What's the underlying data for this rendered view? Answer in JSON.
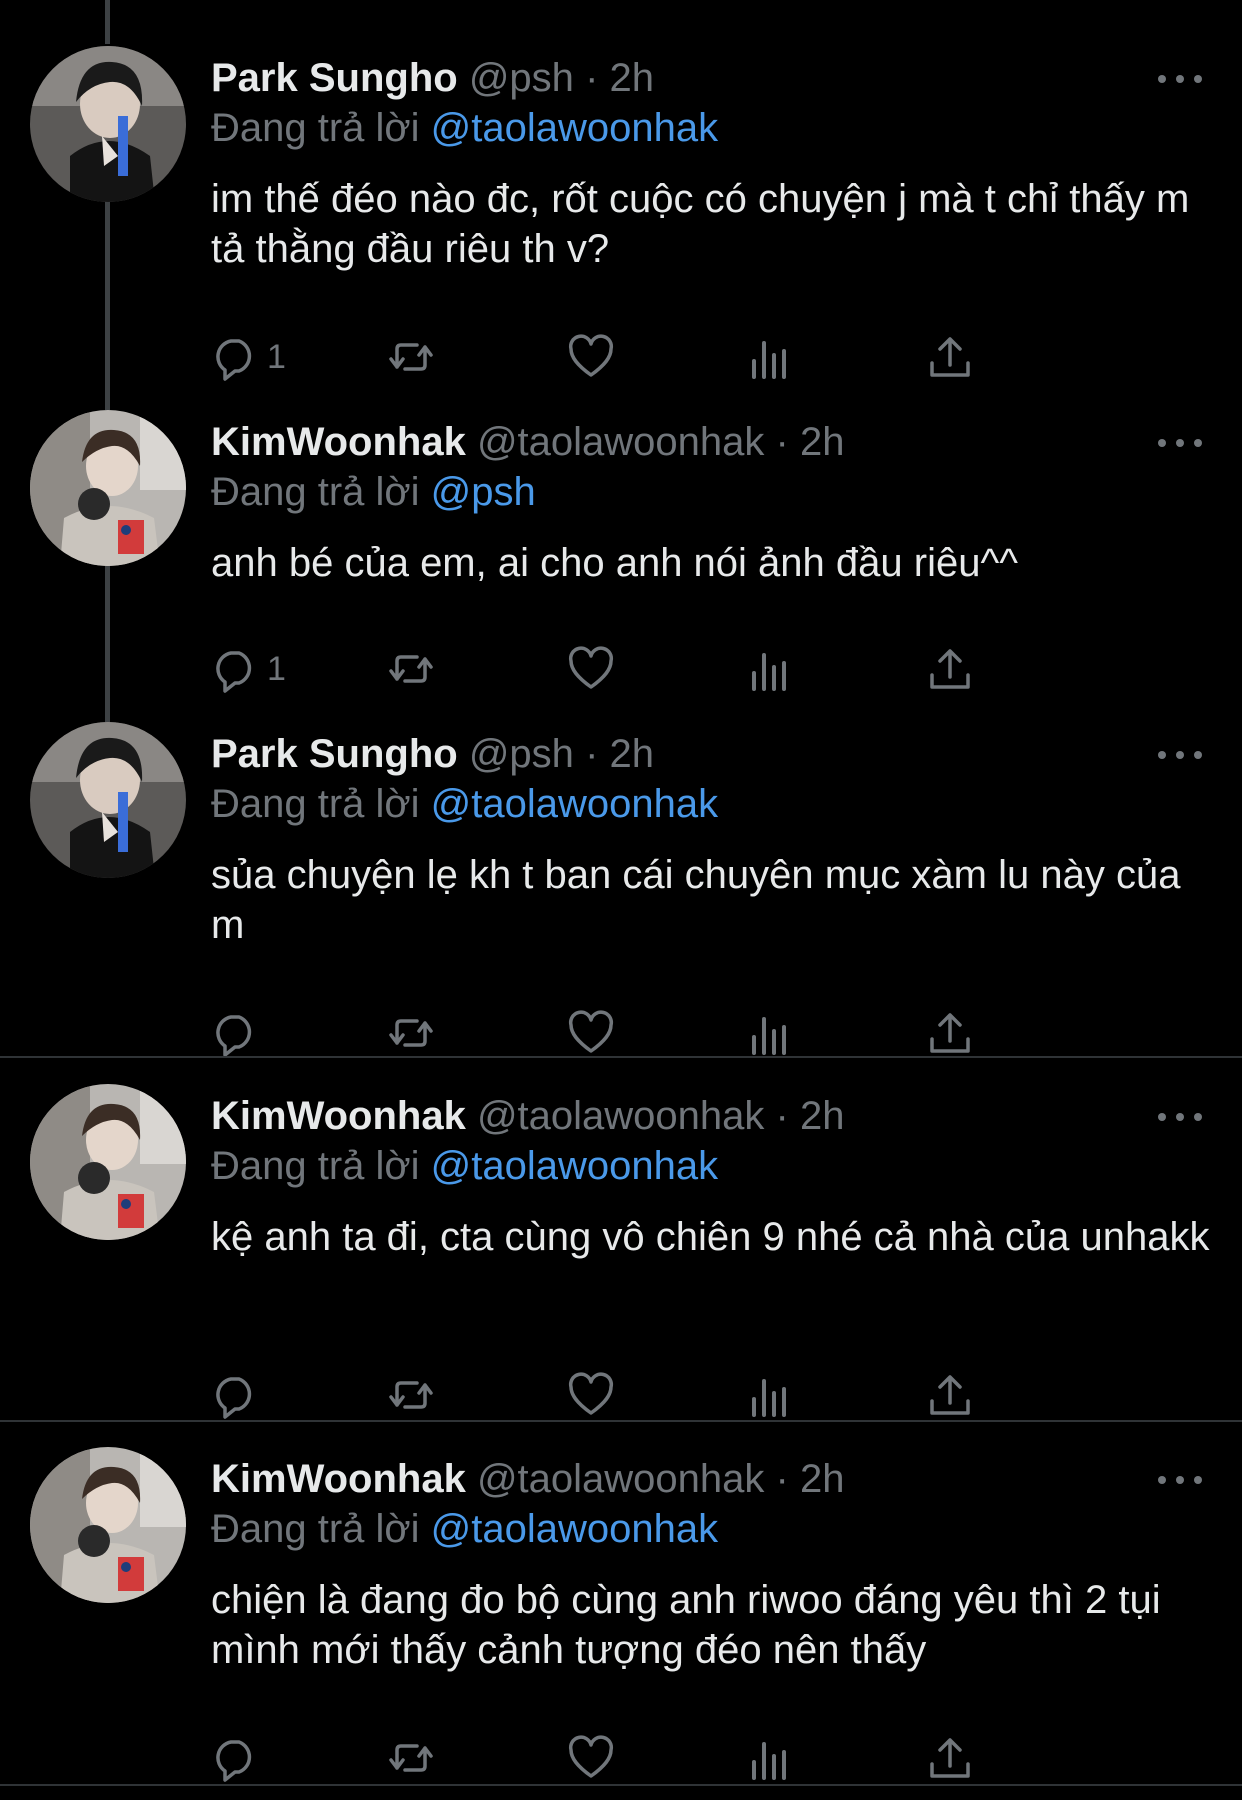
{
  "tweets": [
    {
      "name": "Park Sungho",
      "handle": "@psh",
      "dot": "·",
      "time": "2h",
      "replying_prefix": "Đang trả lời",
      "replying_to": "@taolawoonhak",
      "text": "im thế đéo nào đc, rốt cuộc có chuyện j mà t chỉ thấy m tả thằng đầu riêu th v?",
      "reply_count": "1",
      "avatar": "avatar-park"
    },
    {
      "name": "KimWoonhak",
      "handle": "@taolawoonhak",
      "dot": "·",
      "time": "2h",
      "replying_prefix": "Đang trả lời",
      "replying_to": "@psh",
      "text": "anh bé của em, ai cho anh nói ảnh đầu riêu^^",
      "reply_count": "1",
      "avatar": "avatar-kim"
    },
    {
      "name": "Park Sungho",
      "handle": "@psh",
      "dot": "·",
      "time": "2h",
      "replying_prefix": "Đang trả lời",
      "replying_to": "@taolawoonhak",
      "text": "sủa chuyện lẹ kh t ban cái chuyên mục xàm lu này của m",
      "reply_count": "",
      "avatar": "avatar-park"
    },
    {
      "name": "KimWoonhak",
      "handle": "@taolawoonhak",
      "dot": "·",
      "time": "2h",
      "replying_prefix": "Đang trả lời",
      "replying_to": "@taolawoonhak",
      "text": "kệ anh ta đi, cta cùng vô chiên 9 nhé cả nhà của unhakk",
      "reply_count": "",
      "avatar": "avatar-kim"
    },
    {
      "name": "KimWoonhak",
      "handle": "@taolawoonhak",
      "dot": "·",
      "time": "2h",
      "replying_prefix": "Đang trả lời",
      "replying_to": "@taolawoonhak",
      "text": "chiện là đang đo bộ cùng anh riwoo đáng yêu thì 2 tụi mình mới thấy cảnh tượng đéo nên thấy",
      "reply_count": "",
      "avatar": "avatar-kim"
    }
  ],
  "colors": {
    "background": "#000000",
    "text": "#e7e9ea",
    "secondary": "#71767b",
    "link": "#4a99e9",
    "divider": "#2f3336"
  },
  "icons": [
    "reply-icon",
    "retweet-icon",
    "like-icon",
    "views-icon",
    "share-icon",
    "more-icon"
  ]
}
